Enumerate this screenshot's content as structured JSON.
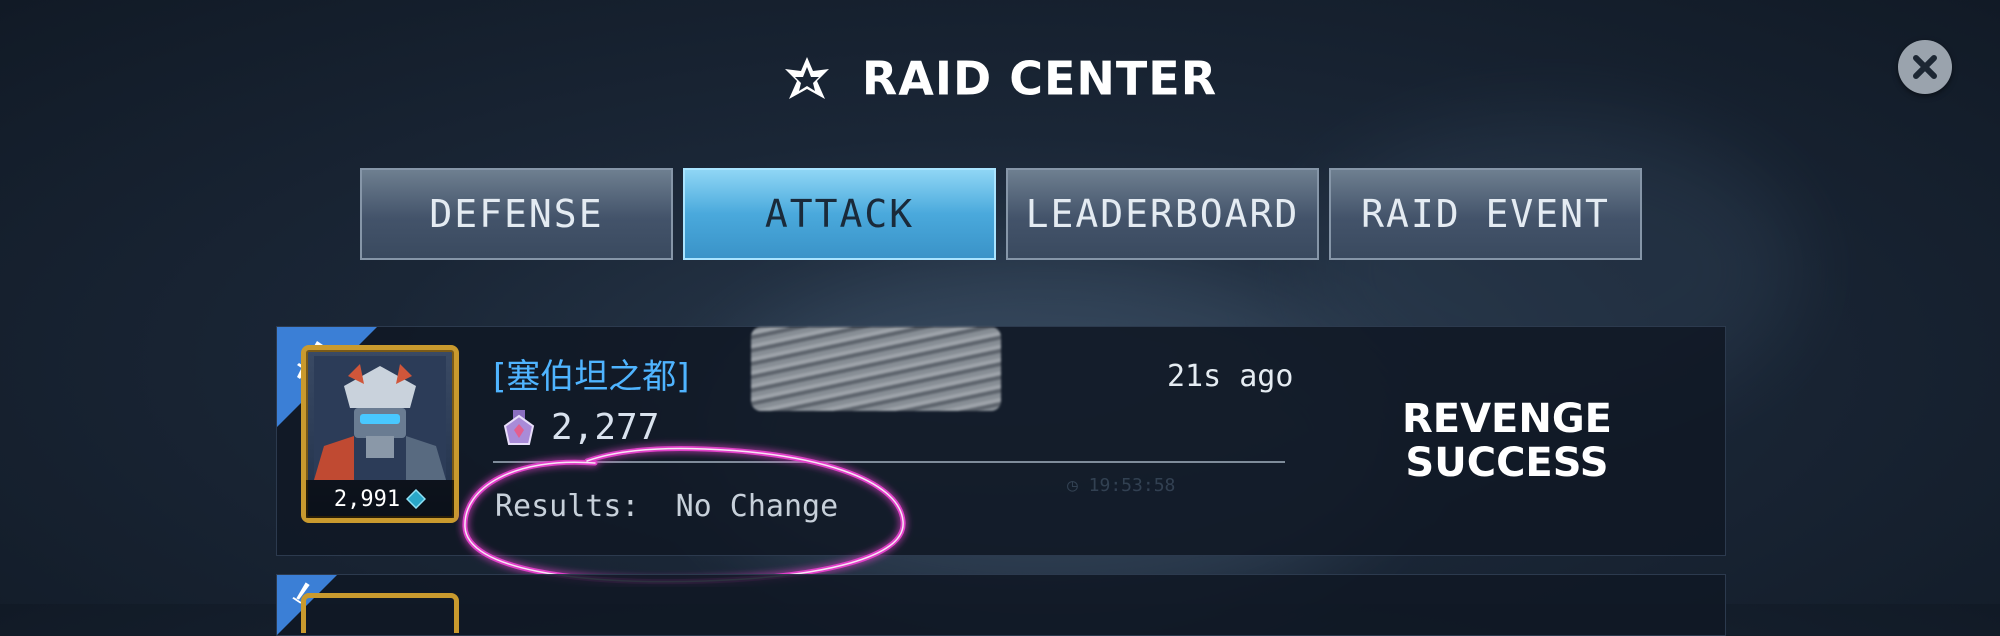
{
  "header": {
    "title": "RAID CENTER",
    "logo_icon": "autobot-faction-icon",
    "close_icon": "close-icon"
  },
  "tabs": [
    {
      "label": "DEFENSE",
      "active": false
    },
    {
      "label": "ATTACK",
      "active": true
    },
    {
      "label": "LEADERBOARD",
      "active": false
    },
    {
      "label": "RAID EVENT",
      "active": false
    }
  ],
  "raid_entries": [
    {
      "type_icon": "sword-icon",
      "avatar_power": "2,991",
      "player_name": "[塞伯坦之都]",
      "time_ago": "21s ago",
      "score": "2,277",
      "results_label": "Results:",
      "results_value": "No Change",
      "status_line1": "REVENGE",
      "status_line2": "SUCCESS"
    }
  ],
  "colors": {
    "tab_active": "#4aa9dc",
    "player_name": "#4fb4ff",
    "corner_badge": "#3b7fd6",
    "avatar_frame": "#c99a2e",
    "annotation_circle": "#e040c8"
  }
}
